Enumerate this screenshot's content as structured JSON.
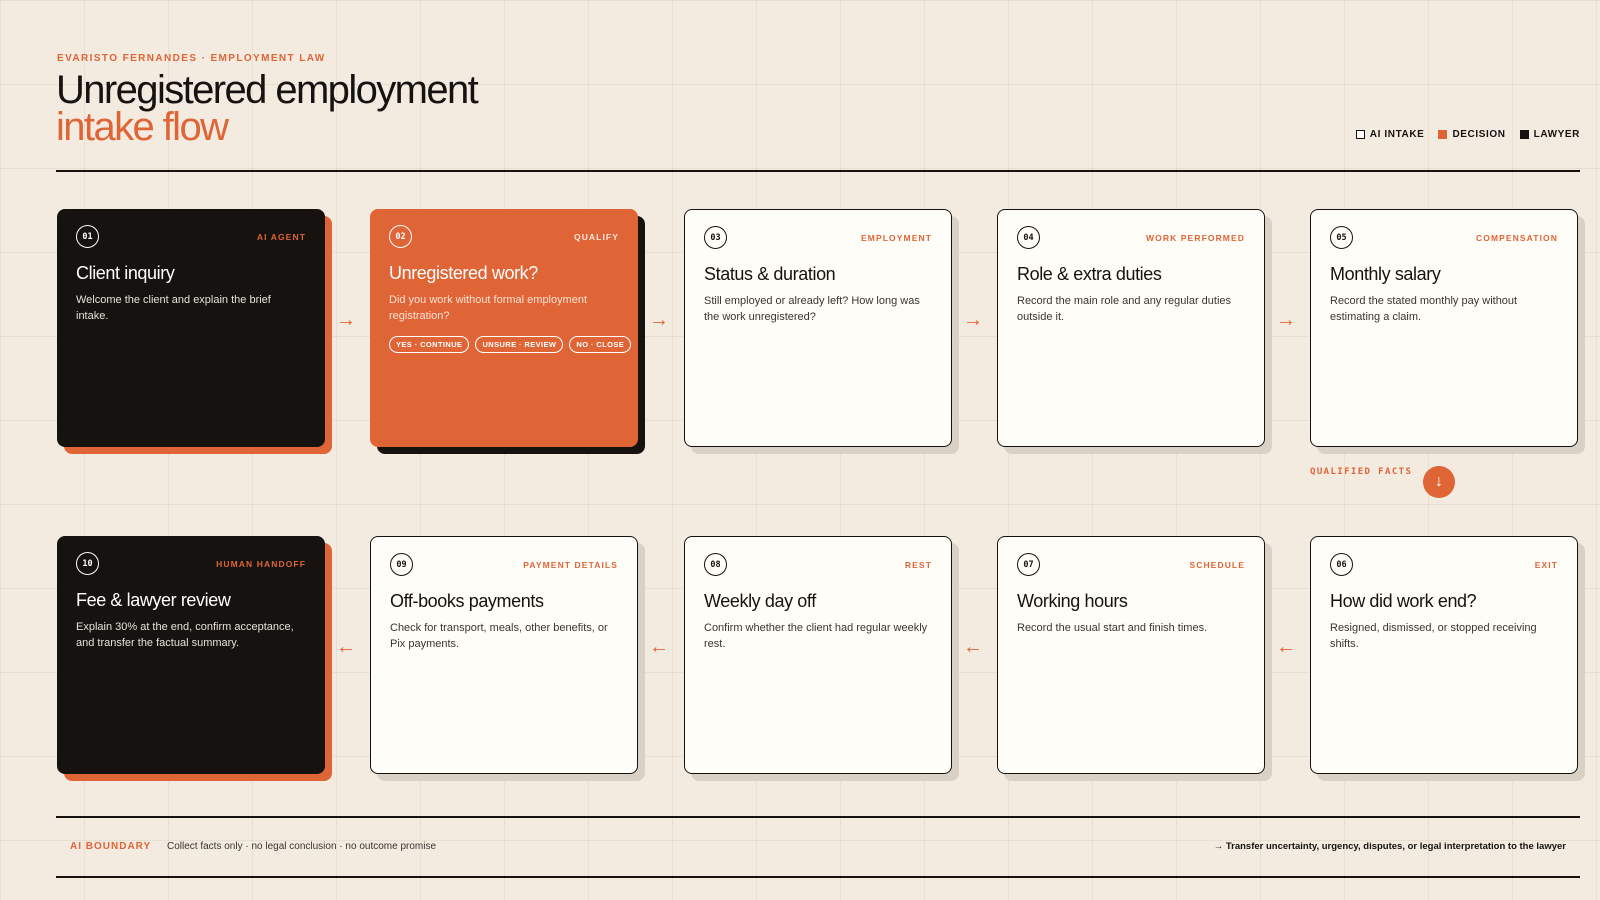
{
  "header": {
    "kicker": "EVARISTO FERNANDES · EMPLOYMENT LAW",
    "title_line1": "Unregistered employment",
    "title_line2": "intake flow"
  },
  "legend": [
    {
      "label": "AI INTAKE",
      "swatch": "outline"
    },
    {
      "label": "DECISION",
      "swatch": "#df6436"
    },
    {
      "label": "LAWYER",
      "swatch": "#151210"
    }
  ],
  "steps": [
    {
      "num": "01",
      "tag": "AI AGENT",
      "title": "Client inquiry",
      "desc": "Welcome the client and explain the brief intake.",
      "style": "dark"
    },
    {
      "num": "02",
      "tag": "QUALIFY",
      "title": "Unregistered work?",
      "desc": "Did you work without formal employment registration?",
      "style": "orange",
      "options": [
        "YES · CONTINUE",
        "UNSURE · REVIEW",
        "NO · CLOSE"
      ]
    },
    {
      "num": "03",
      "tag": "EMPLOYMENT",
      "title": "Status & duration",
      "desc": "Still employed or already left? How long was the work unregistered?",
      "style": "light"
    },
    {
      "num": "04",
      "tag": "WORK PERFORMED",
      "title": "Role & extra duties",
      "desc": "Record the main role and any regular duties outside it.",
      "style": "light"
    },
    {
      "num": "05",
      "tag": "COMPENSATION",
      "title": "Monthly salary",
      "desc": "Record the stated monthly pay without estimating a claim.",
      "style": "light"
    },
    {
      "num": "06",
      "tag": "EXIT",
      "title": "How did work end?",
      "desc": "Resigned, dismissed, or stopped receiving shifts.",
      "style": "light"
    },
    {
      "num": "07",
      "tag": "SCHEDULE",
      "title": "Working hours",
      "desc": "Record the usual start and finish times.",
      "style": "light"
    },
    {
      "num": "08",
      "tag": "REST",
      "title": "Weekly day off",
      "desc": "Confirm whether the client had regular weekly rest.",
      "style": "light"
    },
    {
      "num": "09",
      "tag": "PAYMENT DETAILS",
      "title": "Off-books payments",
      "desc": "Check for transport, meals, other benefits, or Pix payments.",
      "style": "light"
    },
    {
      "num": "10",
      "tag": "HUMAN HANDOFF",
      "title": "Fee & lawyer review",
      "desc": "Explain 30% at the end, confirm acceptance, and transfer the factual summary.",
      "style": "dark"
    }
  ],
  "connector": {
    "label": "QUALIFIED FACTS",
    "arrow_right": "→",
    "arrow_left": "←",
    "arrow_down": "↓"
  },
  "footer": {
    "boundary_label": "AI BOUNDARY",
    "boundary_text": "Collect facts only · no legal conclusion · no outcome promise",
    "transfer_note": "→ Transfer uncertainty, urgency, disputes, or legal interpretation to the lawyer"
  },
  "colors": {
    "accent": "#df6436",
    "ink": "#151210",
    "paper": "#f3ebe0",
    "card": "#fffdf8"
  }
}
